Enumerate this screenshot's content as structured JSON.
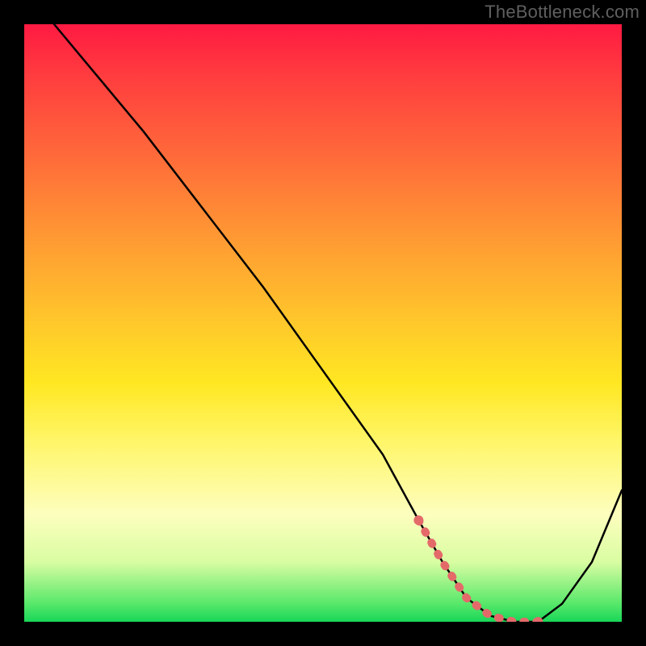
{
  "watermark": "TheBottleneck.com",
  "chart_data": {
    "type": "line",
    "title": "",
    "xlabel": "",
    "ylabel": "",
    "xlim": [
      0,
      100
    ],
    "ylim": [
      0,
      100
    ],
    "series": [
      {
        "name": "curve",
        "x": [
          5,
          10,
          20,
          30,
          40,
          50,
          60,
          66,
          70,
          74,
          78,
          82,
          86,
          90,
          95,
          100
        ],
        "values": [
          100,
          94,
          82,
          69,
          56,
          42,
          28,
          17,
          10,
          4,
          1,
          0,
          0,
          3,
          10,
          22
        ]
      }
    ],
    "flat_region": {
      "x_start": 66,
      "x_end": 86,
      "value": 0
    }
  },
  "colors": {
    "curve_stroke": "#000000",
    "flat_marker": "#e46a6a",
    "frame_bg": "#000000"
  }
}
